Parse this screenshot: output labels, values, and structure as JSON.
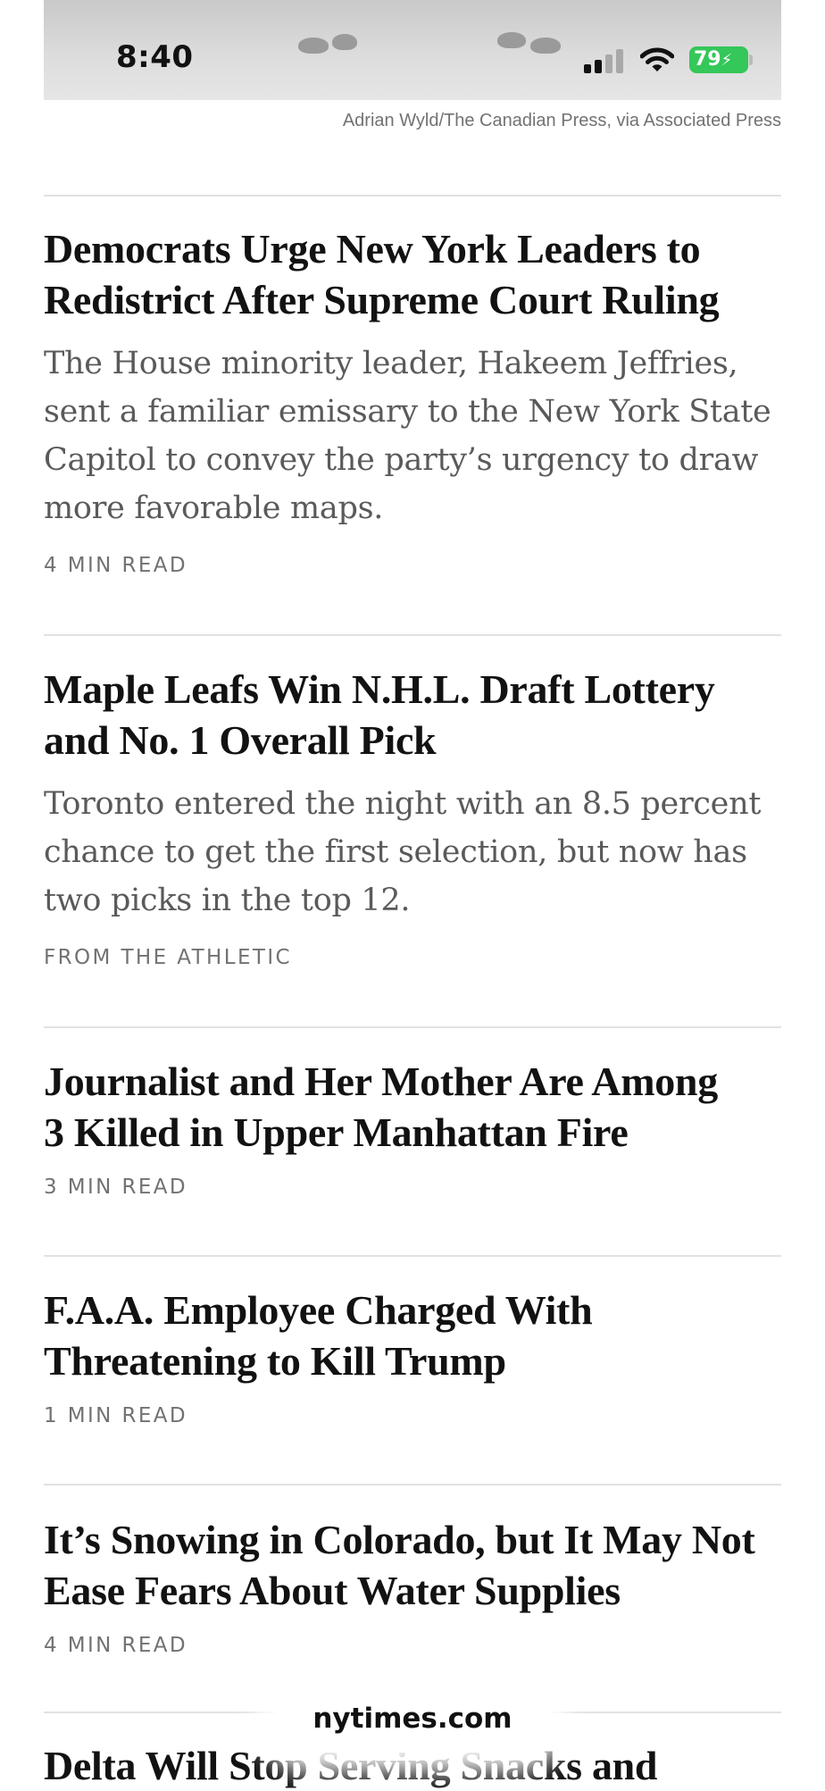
{
  "status_bar": {
    "time": "8:40",
    "battery": "79"
  },
  "photo": {
    "credit": "Adrian Wyld/The Canadian Press, via Associated Press"
  },
  "articles": [
    {
      "headline_lines": [
        "Democrats Urge New York Leaders to",
        "Redistrict After Supreme Court Ruling"
      ],
      "summary_lines": [
        "The House minority leader, Hakeem Jeffries,",
        "sent a familiar emissary to the New York State",
        "Capitol to convey the party’s urgency to draw",
        "more favorable maps."
      ],
      "meta": "4 MIN READ"
    },
    {
      "headline_lines": [
        "Maple Leafs Win N.H.L. Draft Lottery",
        "and No. 1 Overall Pick"
      ],
      "summary_lines": [
        "Toronto entered the night with an 8.5 percent",
        "chance to get the first selection, but now has",
        "two picks in the top 12."
      ],
      "meta": "FROM THE ATHLETIC"
    },
    {
      "headline_lines": [
        "Journalist and Her Mother Are Among",
        "3 Killed in Upper Manhattan Fire"
      ],
      "meta": "3 MIN READ"
    },
    {
      "headline_lines": [
        "F.A.A. Employee Charged With",
        "Threatening to Kill Trump"
      ],
      "meta": "1 MIN READ"
    },
    {
      "headline_lines": [
        "It’s Snowing in Colorado, but It May Not",
        "Ease Fears About Water Supplies"
      ],
      "meta": "4 MIN READ"
    },
    {
      "headline_lines": [
        "Delta Will Stop Serving Snacks and"
      ]
    }
  ],
  "browser": {
    "url": "nytimes.com"
  },
  "colors": {
    "battery": "#34c759",
    "headline": "#121212",
    "summary": "#5a5a5a",
    "meta": "#727272",
    "divider": "#e2e2e2"
  }
}
